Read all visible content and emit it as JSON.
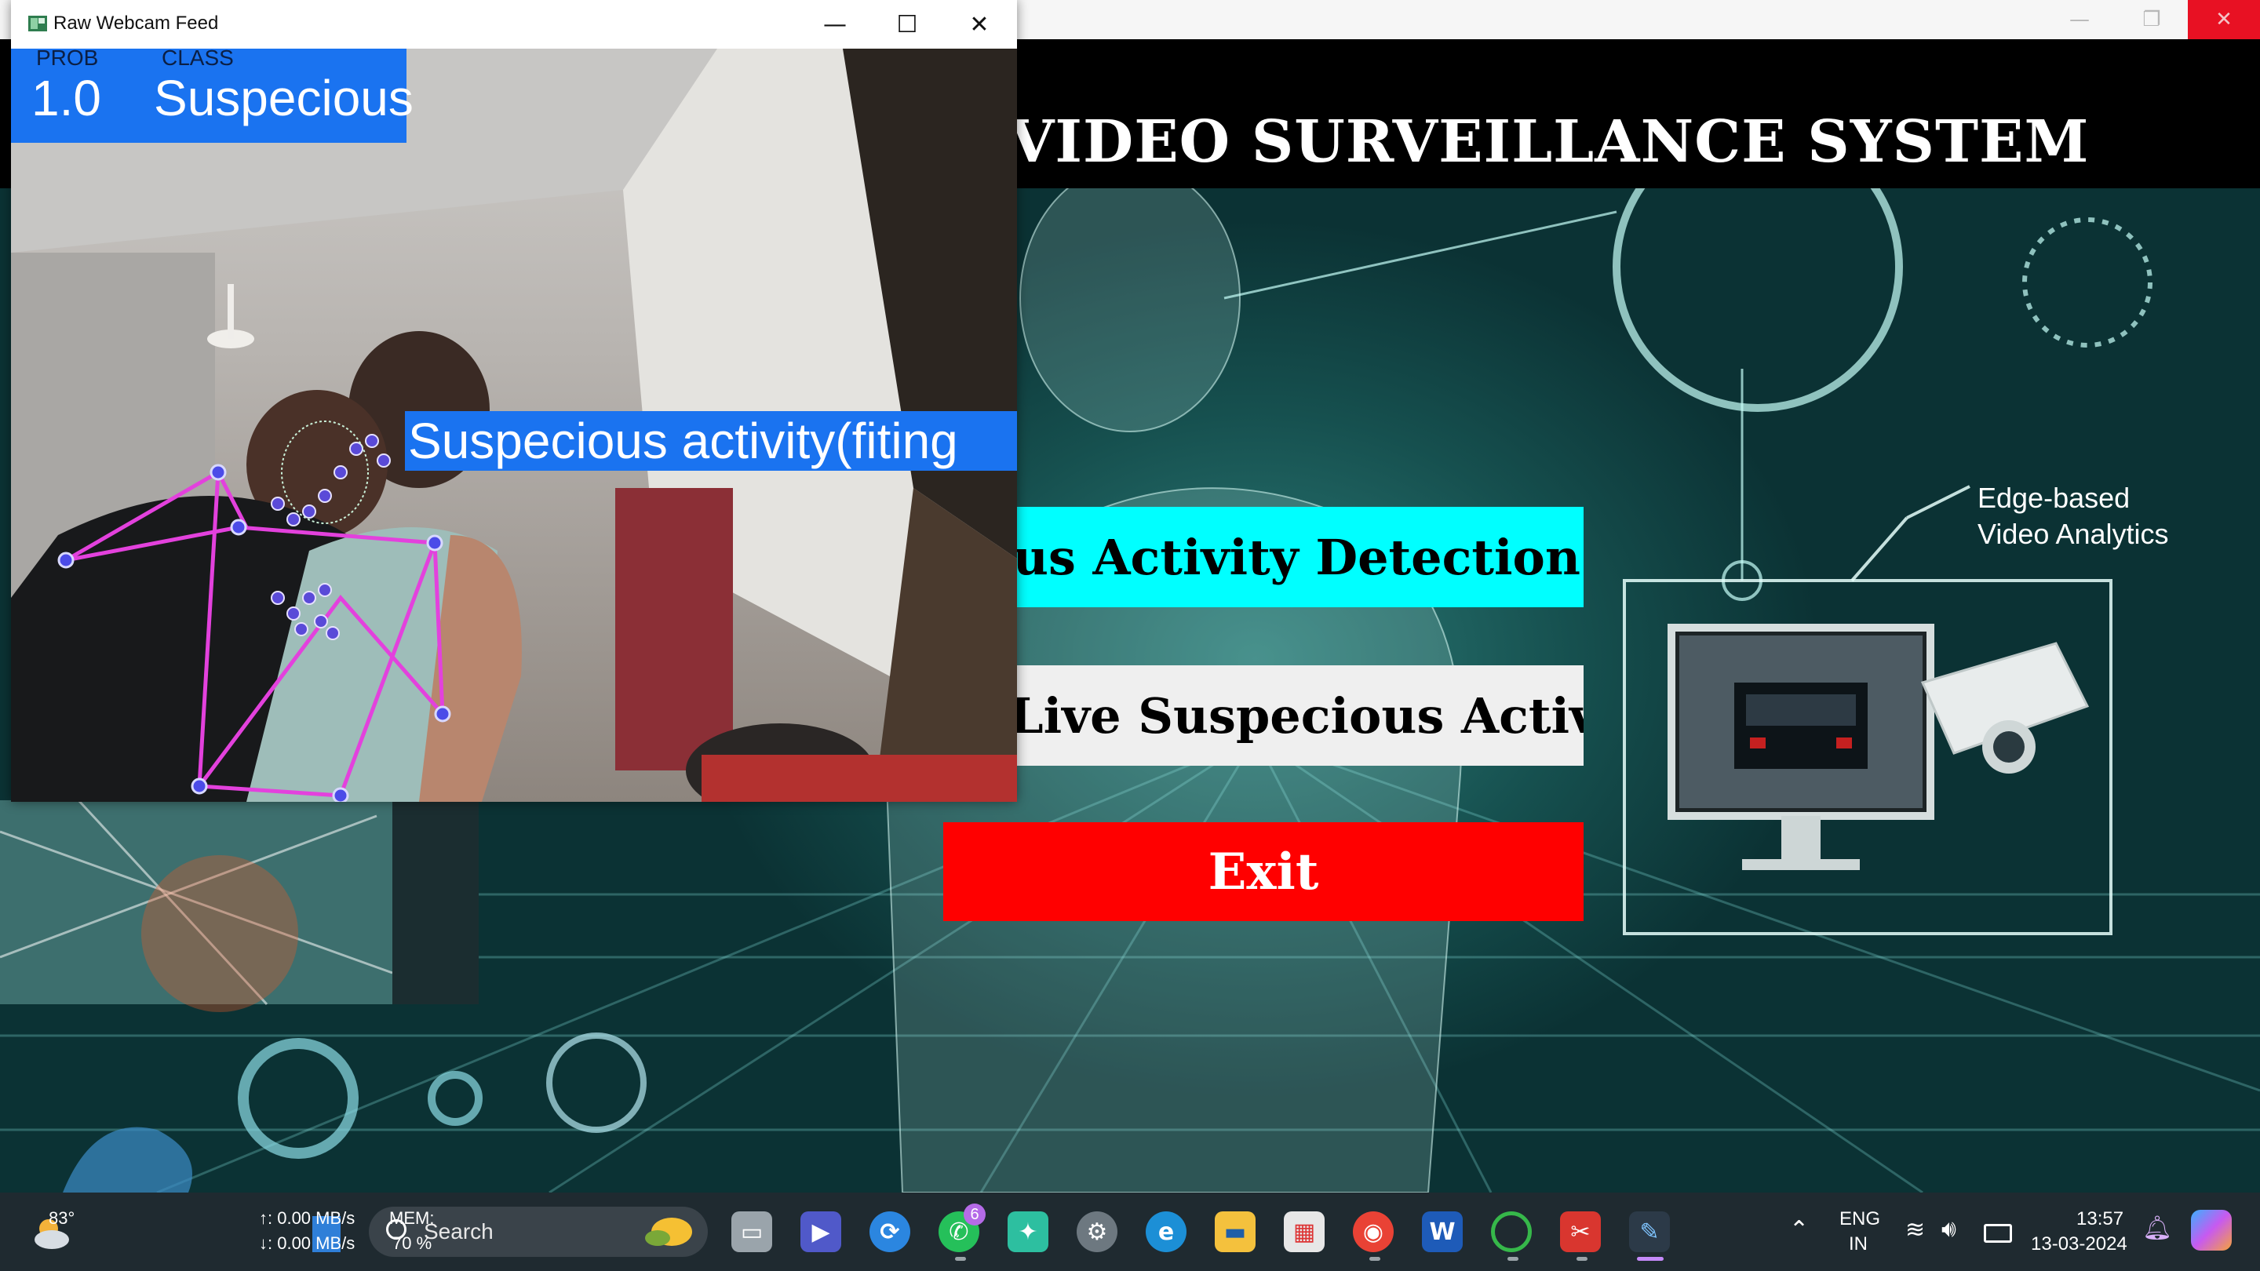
{
  "app": {
    "title": "VIDEO SURVEILLANCE SYSTEM",
    "buttons": {
      "detect": "pecious Activity Detection",
      "live": "Live Suspecious Activity",
      "exit": "Exit"
    },
    "analytics_label_line1": "Edge-based",
    "analytics_label_line2": "Video Analytics",
    "colors": {
      "detect": "#00ffff",
      "live": "#efefef",
      "exit": "#ff0000"
    }
  },
  "webcam": {
    "window_title": "Raw Webcam Feed",
    "prob_label": "PROB",
    "class_label": "CLASS",
    "prob_value": "1.0",
    "class_value": "Suspecious",
    "activity_text": "Suspecious activity(fiting",
    "overlay_color": "#1a73f0"
  },
  "taskbar": {
    "weather_temp": "83°",
    "net_up": "↑: 0.00 MB/s",
    "net_down": "↓: 0.00 MB/s",
    "mem_label": "MEM:",
    "mem_value": "70 %",
    "search_placeholder": "Search",
    "whatsapp_badge": "6",
    "lang_line1": "ENG",
    "lang_line2": "IN",
    "time": "13:57",
    "date": "13-03-2024",
    "icons": [
      "task-view-icon",
      "meet-icon",
      "sync-icon",
      "whatsapp-icon",
      "widgets-icon",
      "settings-icon",
      "edge-icon",
      "file-explorer-icon",
      "store-icon",
      "chrome-icon",
      "word-icon",
      "loading-app-icon",
      "snipping-tool-icon",
      "pen-app-icon"
    ]
  }
}
